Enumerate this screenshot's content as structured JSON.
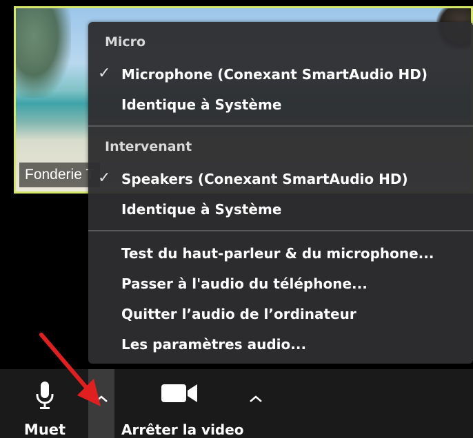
{
  "video_tile": {
    "participant_name": "Fonderie T"
  },
  "audio_menu": {
    "microphone_header": "Micro",
    "microphone_options": [
      {
        "label": "Microphone (Conexant SmartAudio HD)",
        "selected": true
      },
      {
        "label": "Identique à Système",
        "selected": false
      }
    ],
    "speaker_header": "Intervenant",
    "speaker_options": [
      {
        "label": "Speakers (Conexant SmartAudio HD)",
        "selected": true
      },
      {
        "label": "Identique à Système",
        "selected": false
      }
    ],
    "actions": [
      "Test du haut-parleur & du microphone...",
      "Passer à l'audio du téléphone...",
      "Quitter l’audio de l’ordinateur",
      "Les paramètres audio..."
    ],
    "check_glyph": "✓"
  },
  "toolbar": {
    "mute_label": "Muet",
    "video_label": "Arrêter la video"
  },
  "colors": {
    "menu_bg": "#2e2e30",
    "tile_border": "#d5e66a",
    "annotation_arrow": "#e02020"
  }
}
